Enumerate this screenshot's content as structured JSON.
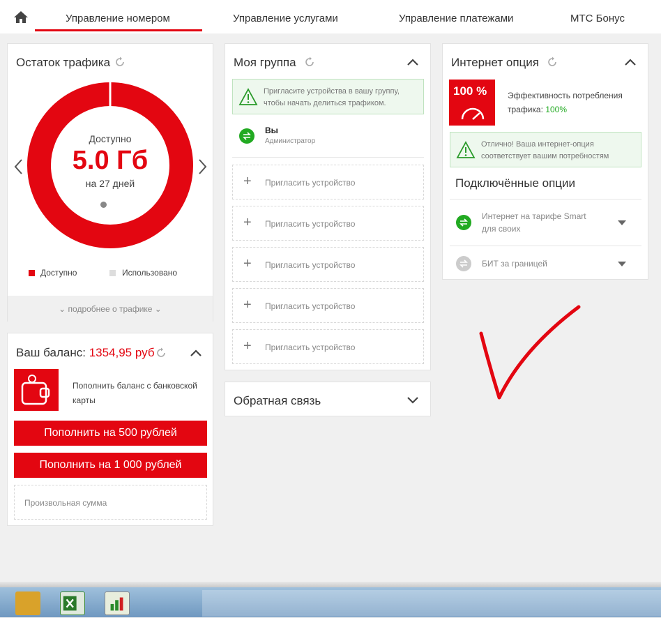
{
  "nav": {
    "tabs": [
      "Управление номером",
      "Управление услугами",
      "Управление платежами",
      "МТС Бонус"
    ]
  },
  "traffic": {
    "title": "Остаток трафика",
    "available_label": "Доступно",
    "amount": "5.0 Гб",
    "period": "на 27 дней",
    "available_fraction": 1.0,
    "legend_available": "Доступно",
    "legend_used": "Использовано",
    "more_link": "подробнее о трафике"
  },
  "balance": {
    "title": "Ваш баланс:",
    "amount": "1354,95 руб",
    "card_text_1": "Пополнить баланс с банковской",
    "card_text_2": "карты",
    "btn_500": "Пополнить на 500 рублей",
    "btn_1000": "Пополнить на 1 000 рублей",
    "custom_placeholder": "Произвольная сумма"
  },
  "group": {
    "title": "Моя группа",
    "alert_line1": "Пригласите устройства в вашу группу,",
    "alert_line2": "чтобы начать делиться трафиком.",
    "member_name": "Вы",
    "member_role": "Администратор",
    "invite_label": "Пригласить устройство",
    "invites": [
      "Пригласить устройство",
      "Пригласить устройство",
      "Пригласить устройство",
      "Пригласить устройство",
      "Пригласить устройство"
    ]
  },
  "feedback": {
    "title": "Обратная связь"
  },
  "internet": {
    "title": "Интернет опция",
    "badge": "100 %",
    "efficiency_line1": "Эффективность потребления",
    "efficiency_label": "трафика:",
    "efficiency_value": "100%",
    "alert_line1": "Отлично! Ваша интернет-опция",
    "alert_line2": "соответствует вашим потребностям",
    "connected_title": "Подключённые опции",
    "option1_line1": "Интернет на тарифе Smart",
    "option1_line2": "для своих",
    "option2": "БИТ за границей"
  },
  "colors": {
    "accent": "#e30611",
    "green": "#22aa22",
    "used": "#dddddd"
  }
}
